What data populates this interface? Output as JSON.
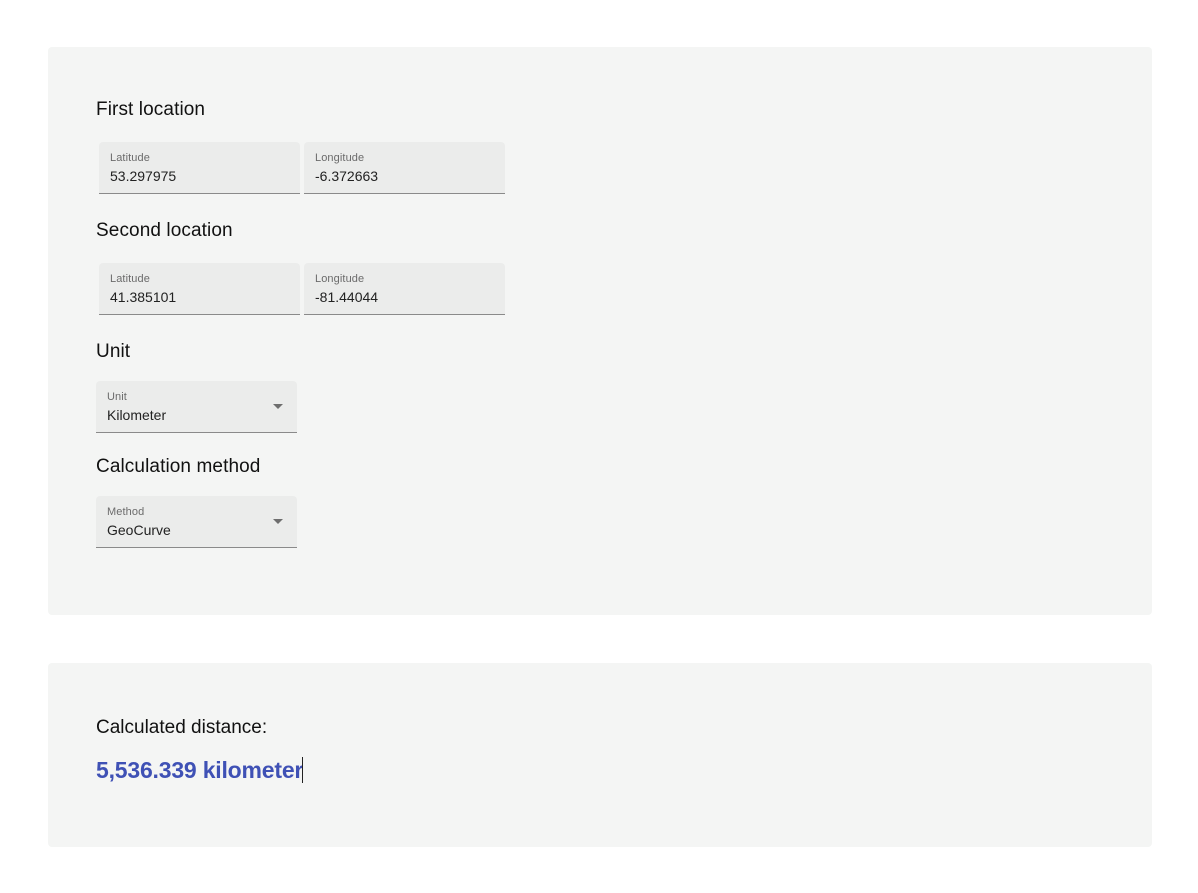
{
  "first_location": {
    "title": "First location",
    "latitude": {
      "label": "Latitude",
      "value": "53.297975"
    },
    "longitude": {
      "label": "Longitude",
      "value": "-6.372663"
    }
  },
  "second_location": {
    "title": "Second location",
    "latitude": {
      "label": "Latitude",
      "value": "41.385101"
    },
    "longitude": {
      "label": "Longitude",
      "value": "-81.44044"
    }
  },
  "unit": {
    "title": "Unit",
    "label": "Unit",
    "selected": "Kilometer",
    "icon": "chevron-down-icon"
  },
  "method": {
    "title": "Calculation method",
    "label": "Method",
    "selected": "GeoCurve",
    "icon": "chevron-down-icon"
  },
  "result": {
    "label": "Calculated distance:",
    "value": "5,536.339 kilometer",
    "color": "#3f51b5"
  }
}
